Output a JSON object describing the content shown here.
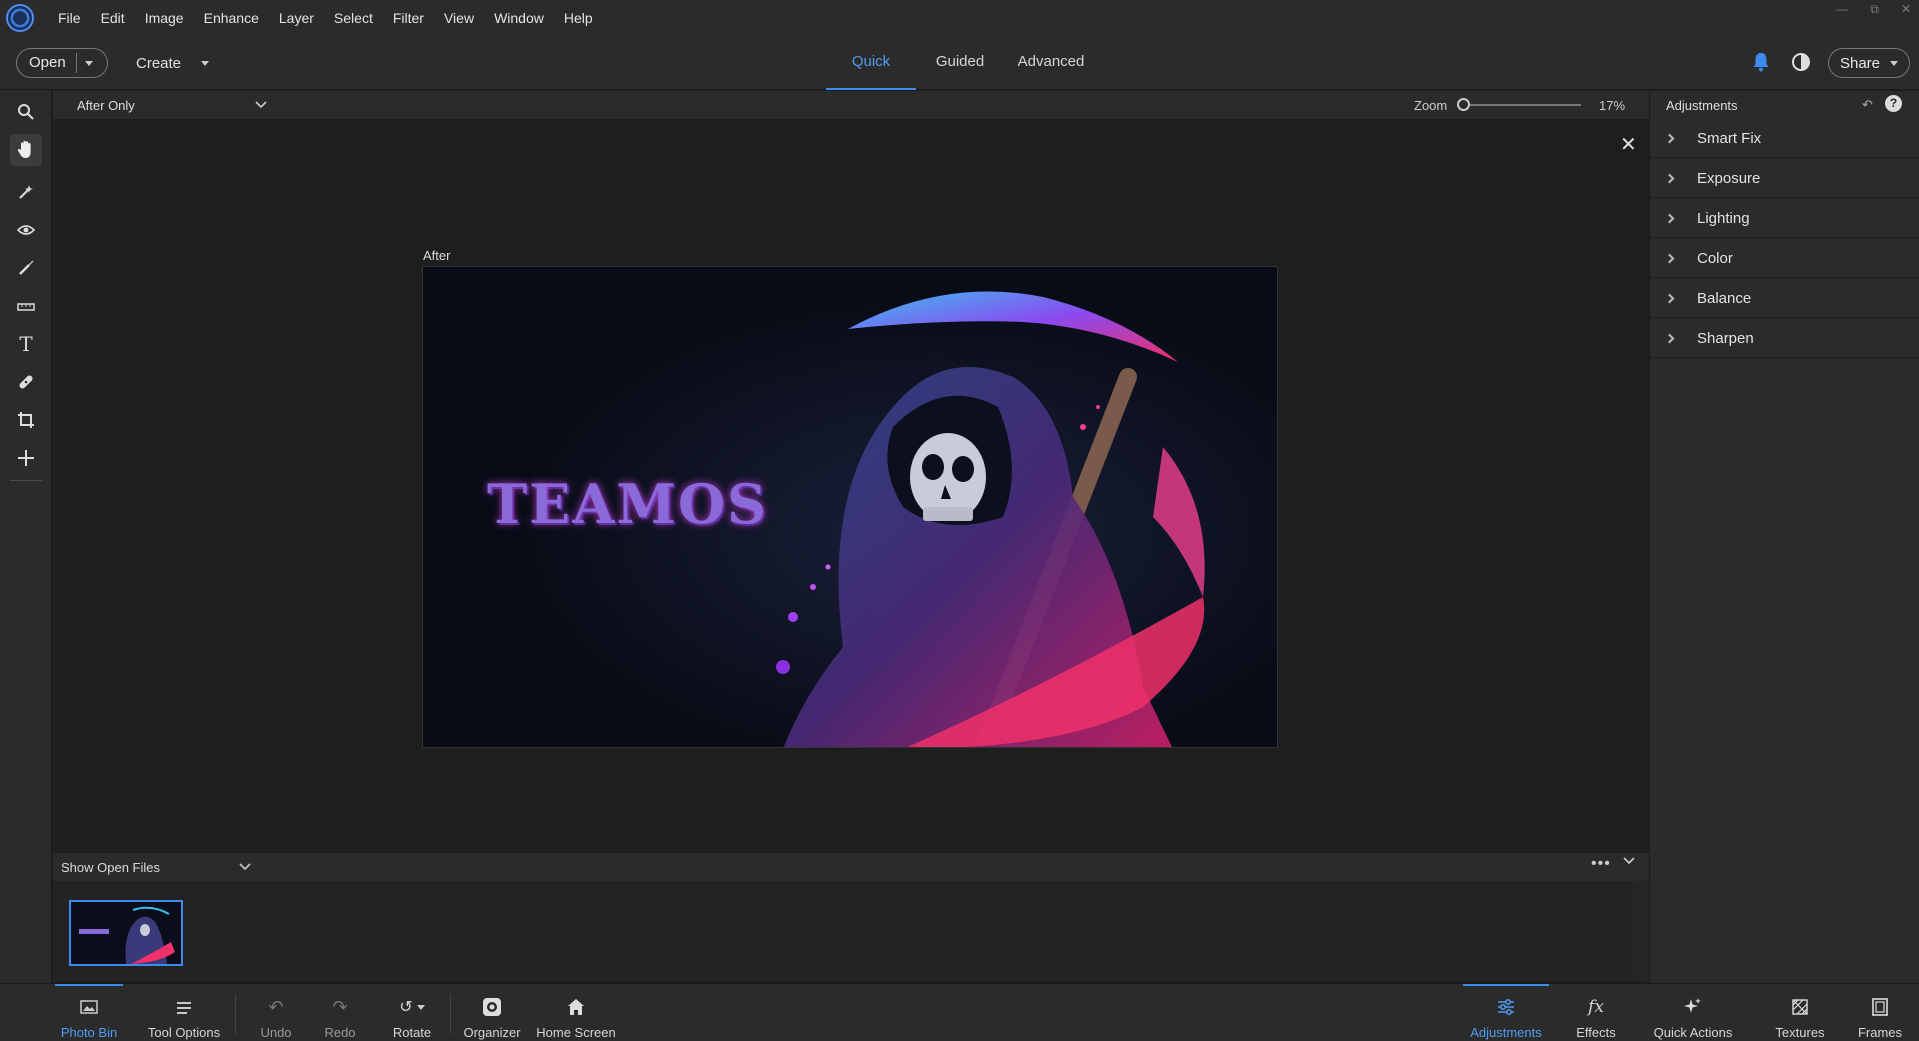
{
  "menu": [
    "File",
    "Edit",
    "Image",
    "Enhance",
    "Layer",
    "Select",
    "Filter",
    "View",
    "Window",
    "Help"
  ],
  "topbar": {
    "open_label": "Open",
    "create_label": "Create",
    "modes": {
      "quick": "Quick",
      "guided": "Guided",
      "advanced": "Advanced"
    },
    "active_mode": "Quick",
    "share_label": "Share"
  },
  "view": {
    "selected": "After Only",
    "after_label": "After",
    "zoom_label": "Zoom",
    "zoom_value": "17%"
  },
  "artwork": {
    "title_text": "TEAMOS"
  },
  "bin": {
    "selected": "Show Open Files"
  },
  "bottombar": {
    "photo_bin": "Photo Bin",
    "tool_options": "Tool Options",
    "undo": "Undo",
    "redo": "Redo",
    "rotate": "Rotate",
    "organizer": "Organizer",
    "home_screen": "Home Screen",
    "adjustments": "Adjustments",
    "effects": "Effects",
    "quick_actions": "Quick Actions",
    "textures": "Textures",
    "frames": "Frames"
  },
  "panel": {
    "title": "Adjustments",
    "items": [
      "Smart Fix",
      "Exposure",
      "Lighting",
      "Color",
      "Balance",
      "Sharpen"
    ]
  },
  "tools": [
    "zoom-icon",
    "hand-icon",
    "quick-selection-icon",
    "red-eye-icon",
    "whiten-teeth-icon",
    "straighten-icon",
    "text-icon",
    "spot-healing-icon",
    "crop-icon",
    "move-icon"
  ],
  "colors": {
    "accent": "#3d8af0",
    "panel": "#2b2b2b",
    "canvas": "#1e1e1e"
  }
}
